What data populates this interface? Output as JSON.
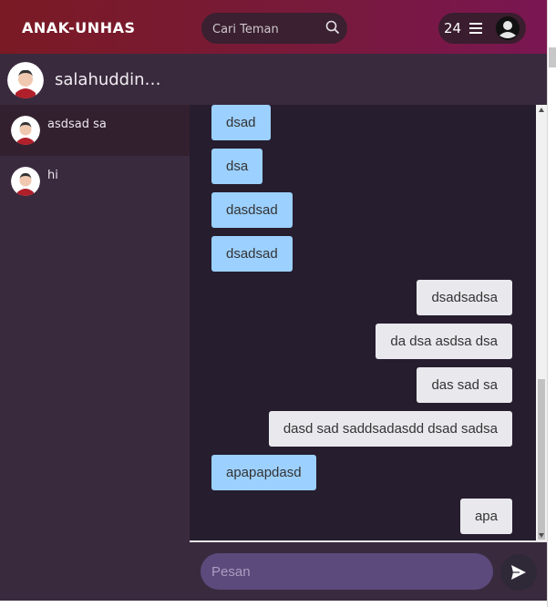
{
  "navbar": {
    "brand": "ANAK-UNHAS",
    "search_placeholder": "Cari Teman",
    "notification_count": "24",
    "menu_icon": "hamburger-icon",
    "profile_icon": "user-circle-icon",
    "gradient": [
      "#7a1a24",
      "#7a1652"
    ]
  },
  "sidebar": {
    "current_user": "salahuddin…",
    "contacts": [
      {
        "name": "asdsad sa",
        "active": true
      },
      {
        "name": "hi",
        "active": false
      }
    ]
  },
  "chat": {
    "messages": [
      {
        "text": "dsad",
        "from": "me"
      },
      {
        "text": "dsa",
        "from": "me"
      },
      {
        "text": "dasdsad",
        "from": "me"
      },
      {
        "text": "dsadsad",
        "from": "me"
      },
      {
        "text": "dsadsadsa",
        "from": "them"
      },
      {
        "text": "da dsa asdsa dsa",
        "from": "them"
      },
      {
        "text": "das sad sa",
        "from": "them"
      },
      {
        "text": "dasd sad saddsadasdd dsad sadsa",
        "from": "them"
      },
      {
        "text": "apapapdasd",
        "from": "me"
      },
      {
        "text": "apa",
        "from": "them"
      }
    ],
    "input_placeholder": "Pesan",
    "send_icon": "send-icon",
    "colors": {
      "me": "#9cd0ff",
      "them": "#e9e9ed"
    }
  }
}
